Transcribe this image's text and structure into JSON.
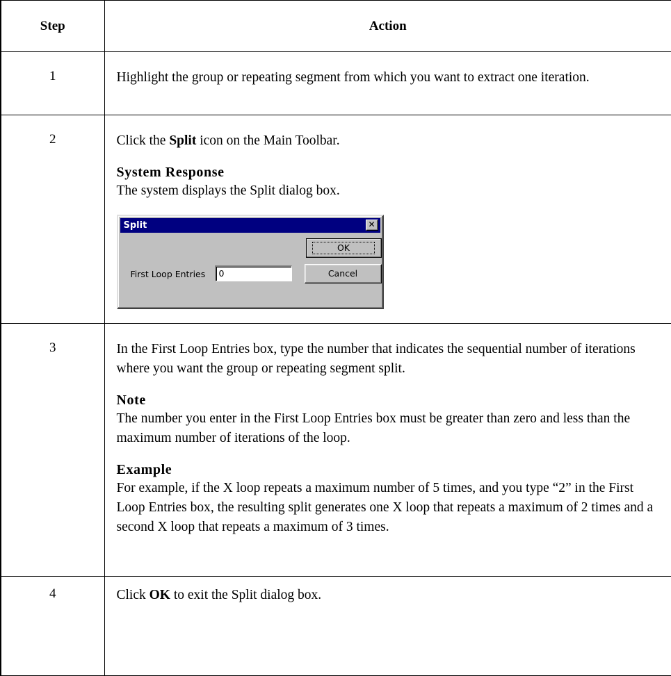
{
  "table": {
    "header": {
      "step": "Step",
      "action": "Action"
    },
    "rows": [
      {
        "step": "1",
        "text": "Highlight the group or repeating segment from which you want to extract one iteration."
      },
      {
        "step": "2",
        "text_before": "Click the ",
        "bold": "Split",
        "text_after": " icon on the Main Toolbar.",
        "response_heading": "System Response",
        "response_text": "The system displays the Split dialog box."
      },
      {
        "step": "3",
        "text": "In the First Loop Entries box, type the number that indicates the sequential number of iterations where you want the group or repeating segment split.",
        "note_heading": "Note",
        "note_text": "The number you enter in the First Loop Entries box must be greater than zero and less than the maximum number of iterations of the loop.",
        "example_heading": "Example",
        "example_text": "For example, if the X loop repeats a maximum number of 5 times, and you type “2” in the First Loop Entries box, the resulting split generates one X loop that repeats a maximum of 2 times and a second X loop that repeats a maximum of 3 times."
      },
      {
        "step": "4",
        "text_before": "Click ",
        "bold": "OK",
        "text_after": " to exit the Split dialog box."
      }
    ]
  },
  "dialog": {
    "title": "Split",
    "close_glyph": "✕",
    "field_label": "First Loop Entries",
    "field_value": "0",
    "ok_label": "OK",
    "cancel_label": "Cancel"
  }
}
